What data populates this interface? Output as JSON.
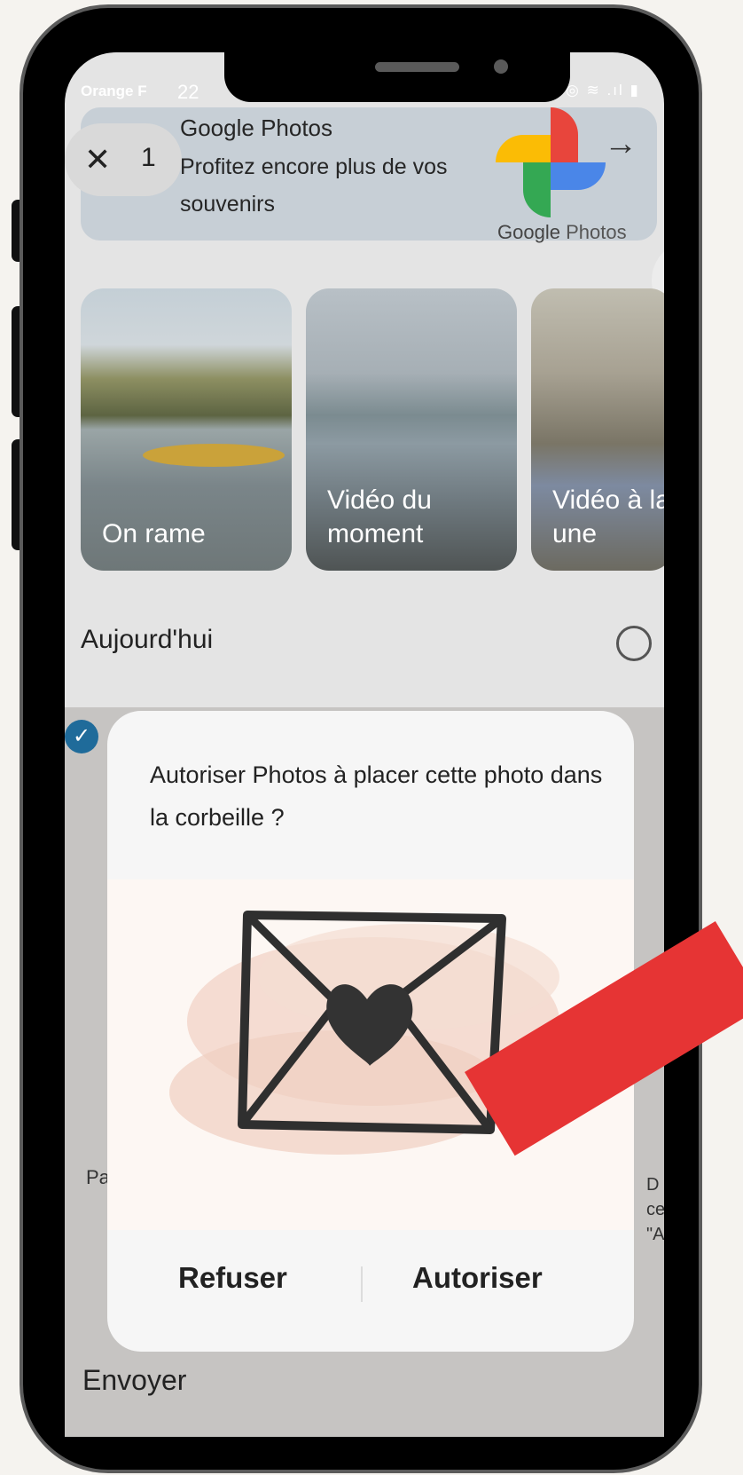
{
  "status_bar": {
    "carrier": "Orange F",
    "time": "22",
    "icons": "◎ ≋ .ıl ▮"
  },
  "selection": {
    "close_label": "✕",
    "count": "1"
  },
  "banner": {
    "title": "Google Photos",
    "text": "Profitez encore plus de vos souvenirs",
    "logo_caption_brand": "Google",
    "logo_caption_product": "Photos",
    "arrow": "→"
  },
  "memories": [
    {
      "label_line1": "On rame",
      "label_line2": ""
    },
    {
      "label_line1": "Vidéo du",
      "label_line2": "moment"
    },
    {
      "label_line1": "Vidéo à la",
      "label_line2": "une"
    }
  ],
  "section": {
    "title": "Aujourd'hui"
  },
  "bottom_sheet": {
    "left_text": "Pa",
    "right_line1": "D",
    "right_line2": "ce",
    "right_line3": "\"A",
    "send_label": "Envoyer"
  },
  "dialog": {
    "title": "Autoriser Photos à placer cette photo dans la corbeille ?",
    "refuse_label": "Refuser",
    "allow_label": "Autoriser"
  },
  "colors": {
    "accent_red": "#e63434",
    "dialog_bg": "#f6f6f6",
    "check_blue": "#1f6b9a"
  }
}
